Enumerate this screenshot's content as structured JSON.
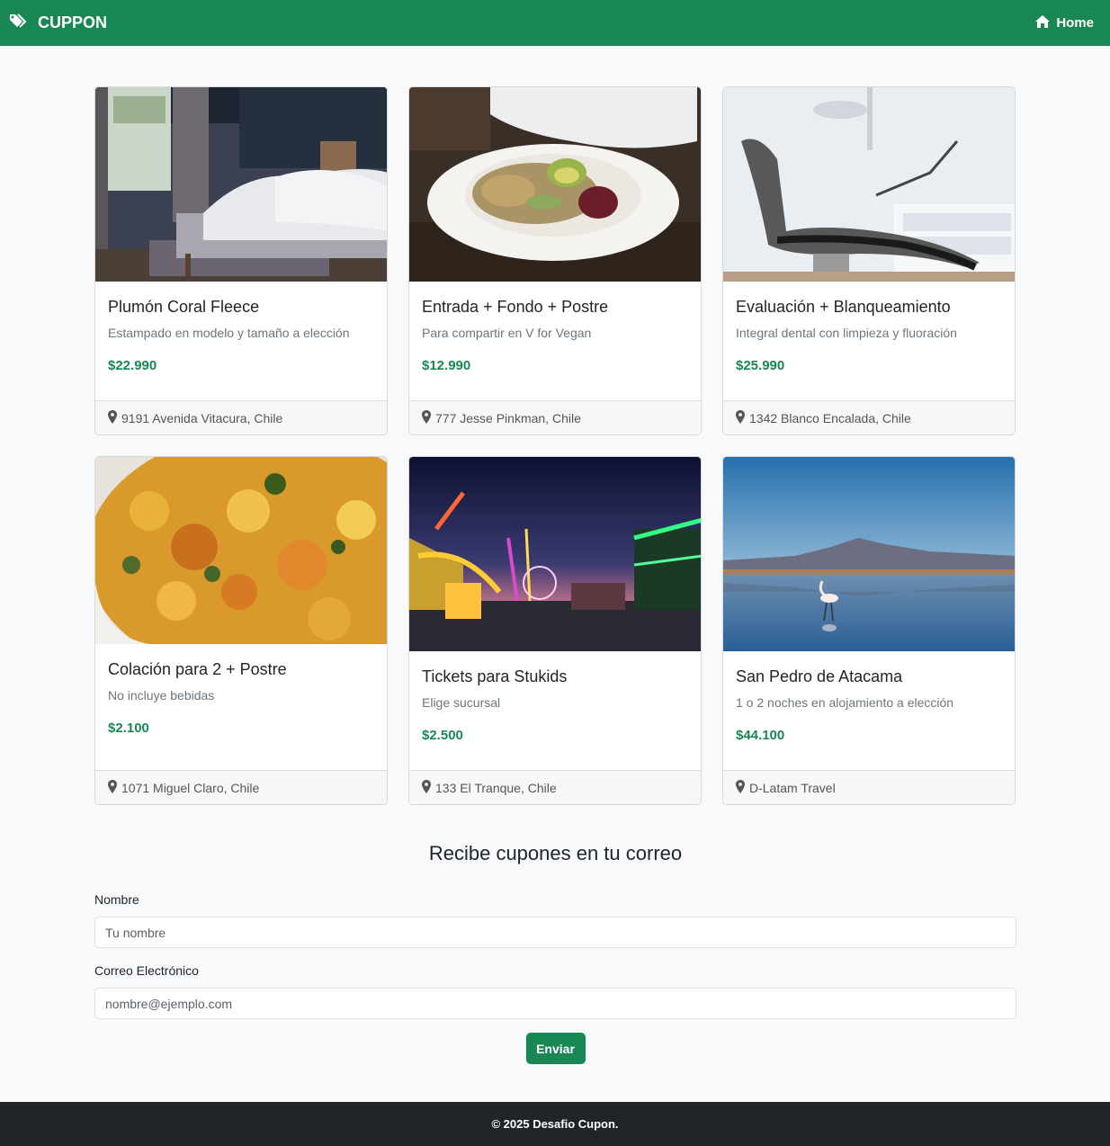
{
  "navbar": {
    "brand": "CUPPON",
    "home_label": "Home",
    "brand_icon": "tags-icon",
    "home_icon": "home-icon"
  },
  "colors": {
    "primary": "#198754",
    "footer_bg": "#212529"
  },
  "cards": [
    {
      "title": "Plumón Coral Fleece",
      "description": "Estampado en modelo y tamaño a elección",
      "price": "$22.990",
      "location": "9191 Avenida Vitacura, Chile",
      "image": "bedroom-photo"
    },
    {
      "title": "Entrada + Fondo + Postre",
      "description": "Para compartir en V for Vegan",
      "price": "$12.990",
      "location": "777 Jesse Pinkman, Chile",
      "image": "vegan-salad-photo"
    },
    {
      "title": "Evaluación + Blanqueamiento",
      "description": "Integral dental con limpieza y fluoración",
      "price": "$25.990",
      "location": "1342 Blanco Encalada, Chile",
      "image": "dental-chair-photo"
    },
    {
      "title": "Colación para 2 + Postre",
      "description": "No incluye bebidas",
      "price": "$2.100",
      "location": "1071 Miguel Claro, Chile",
      "image": "food-dish-photo"
    },
    {
      "title": "Tickets para Stukids",
      "description": "Elige sucursal",
      "price": "$2.500",
      "location": "133 El Tranque, Chile",
      "image": "amusement-park-photo"
    },
    {
      "title": "San Pedro de Atacama",
      "description": "1 o 2 noches en alojamiento a elección",
      "price": "$44.100",
      "location": "D-Latam Travel",
      "image": "flamingo-lagoon-photo"
    }
  ],
  "subscribe": {
    "title": "Recibe cupones en tu correo",
    "name_label": "Nombre",
    "name_placeholder": "Tu nombre",
    "email_label": "Correo Electrónico",
    "email_placeholder": "nombre@ejemplo.com",
    "submit_label": "Enviar"
  },
  "footer": {
    "text": "© 2025 Desafio Cupon."
  }
}
